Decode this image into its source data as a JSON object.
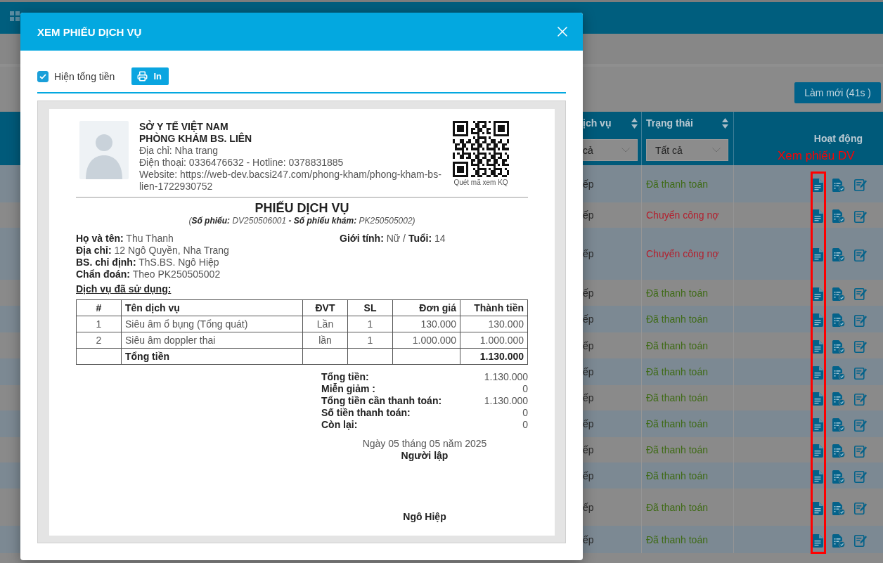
{
  "background_page": {
    "refresh_button": "Làm mới (41s )",
    "table": {
      "columns": [
        {
          "kind": "filter",
          "label": "ịch vụ",
          "filter": "cả"
        },
        {
          "kind": "filter",
          "label": "Trạng thái",
          "filter": "Tất cả"
        },
        {
          "kind": "plain",
          "label": "Hoạt động"
        }
      ],
      "rows": [
        {
          "column_1": "ếp",
          "status": "Đã thanh toán",
          "color": "#3f6b16"
        },
        {
          "column_1": "ếp",
          "status": "Chuyển công nợ",
          "color": "#b3202e"
        },
        {
          "column_1": "ếp",
          "status": "Chuyển công nợ",
          "color": "#b3202e"
        },
        {
          "column_1": "ếp",
          "status": "Đã thanh toán",
          "color": "#3f6b16"
        },
        {
          "column_1": "ếp",
          "status": "Đã thanh toán",
          "color": "#3f6b16"
        },
        {
          "column_1": "ếp",
          "status": "Đã thanh toán",
          "color": "#3f6b16"
        },
        {
          "column_1": "ếp",
          "status": "Đã thanh toán",
          "color": "#3f6b16"
        },
        {
          "column_1": "ếp",
          "status": "Đã thanh toán",
          "color": "#3f6b16"
        },
        {
          "column_1": "ếp",
          "status": "Đã thanh toán",
          "color": "#3f6b16"
        },
        {
          "column_1": "ếp",
          "status": "Đã thanh toán",
          "color": "#3f6b16"
        },
        {
          "column_1": "ếp",
          "status": "Đã thanh toán",
          "color": "#3f6b16"
        },
        {
          "column_1": "ếp",
          "status": "Đã thanh toán",
          "color": "#3f6b16"
        },
        {
          "column_1": "ếp",
          "status": "Đã thanh toán",
          "color": "#3f6b16"
        }
      ]
    }
  },
  "annotation": {
    "label": "Xem phiếu DV"
  },
  "modal": {
    "title": "XEM PHIẾU DỊCH VỤ",
    "show_total": {
      "label": "Hiện tổng tiền",
      "checked": true
    },
    "print_button": "In",
    "receipt": {
      "clinic": {
        "department": "SỞ Y TẾ VIỆT NAM",
        "name": "PHÒNG KHÁM BS. LIÊN",
        "address": "Địa chỉ: Nha trang",
        "phone": "Điện thoại: 0336476632 - Hotline: 0378831885",
        "website": "Website: https://web-dev.bacsi247.com/phong-kham/phong-kham-bs-lien-1722930752"
      },
      "qr_caption": "Quét mã xem KQ",
      "title": "PHIẾU DỊCH VỤ",
      "subtitle": "(**Số phiếu:** DV250506001 **- Số phiếu khám:** PK250505002)",
      "patient": {
        "name": "**Họ và tên:** Thu Thanh",
        "gender_age": "**Giới tính:** Nữ / **Tuổi:** 14",
        "address": "**Địa chỉ:** 12 Ngô Quyền, Nha Trang",
        "doctor": "**BS. chỉ định:** ThS.BS. Ngô Hiệp",
        "diagnosis": "**Chẩn đoán:** Theo PK250505002"
      },
      "services": {
        "heading": "Dịch vụ đã sử dụng:",
        "columns": [
          "#",
          "Tên dịch vụ",
          "ĐVT",
          "SL",
          "Đơn giá",
          "Thành tiền"
        ],
        "rows": [
          [
            "1",
            "Siêu âm ổ bụng (Tổng quát)",
            "Lần",
            "1",
            "130.000",
            "130.000"
          ],
          [
            "2",
            "Siêu âm doppler thai",
            "lần",
            "1",
            "1.000.000",
            "1.000.000"
          ]
        ],
        "total": {
          "label": "Tổng tiền",
          "amount": "1.130.000"
        }
      },
      "summary": [
        {
          "label": "Tổng tiền:",
          "value": "1.130.000"
        },
        {
          "label": "Miễn giảm :",
          "value": "0"
        },
        {
          "label": "Tổng tiền cần thanh toán:",
          "value": "1.130.000"
        },
        {
          "label": "Số tiền thanh toán:",
          "value": "0"
        },
        {
          "label": "Còn lại:",
          "value": "0"
        }
      ],
      "signature": {
        "date": "Ngày 05 tháng 05 năm 2025",
        "role": "Người lập",
        "name": "Ngô Hiệp"
      }
    }
  }
}
